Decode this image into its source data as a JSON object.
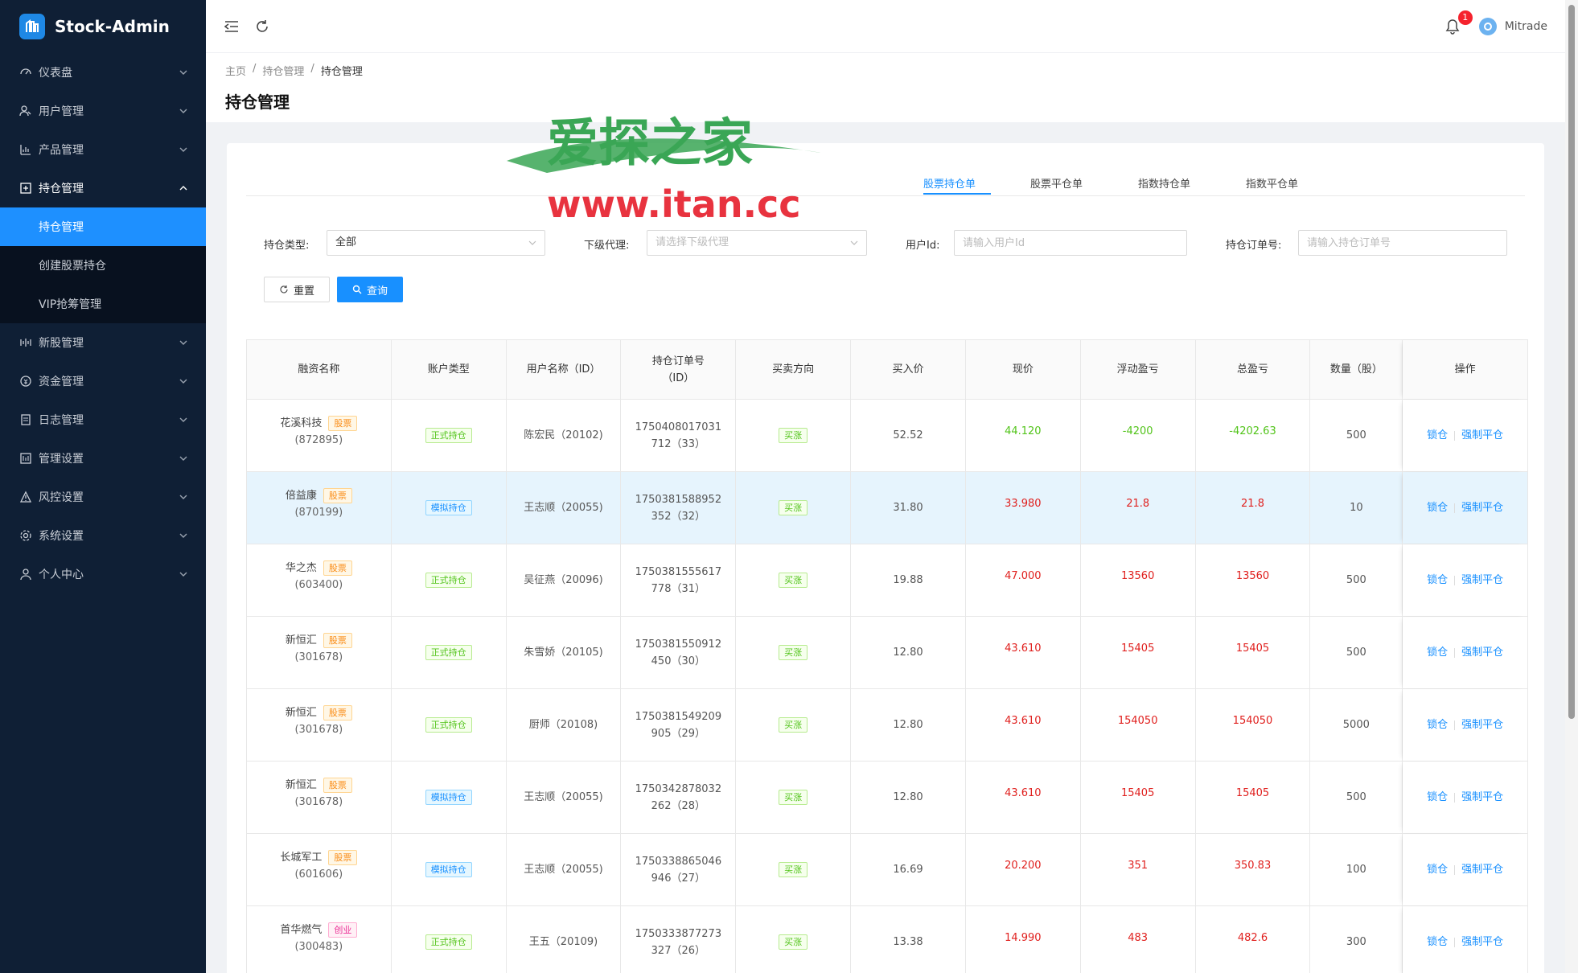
{
  "app": {
    "title": "Stock-Admin"
  },
  "sidebar": {
    "items": [
      {
        "label": "仪表盘",
        "icon": "dashboard-icon"
      },
      {
        "label": "用户管理",
        "icon": "users-icon"
      },
      {
        "label": "产品管理",
        "icon": "chart-icon"
      },
      {
        "label": "持仓管理",
        "icon": "position-icon",
        "open": true
      },
      {
        "label": "新股管理",
        "icon": "ipo-icon"
      },
      {
        "label": "资金管理",
        "icon": "money-icon"
      },
      {
        "label": "日志管理",
        "icon": "log-icon"
      },
      {
        "label": "管理设置",
        "icon": "admin-settings-icon"
      },
      {
        "label": "风控设置",
        "icon": "risk-icon"
      },
      {
        "label": "系统设置",
        "icon": "gear-icon"
      },
      {
        "label": "个人中心",
        "icon": "user-icon"
      }
    ],
    "submenu": [
      {
        "label": "持仓管理",
        "active": true
      },
      {
        "label": "创建股票持仓"
      },
      {
        "label": "VIP抢筹管理"
      }
    ]
  },
  "header": {
    "notification_count": "1",
    "user_name": "Mitrade"
  },
  "breadcrumb": [
    "主页",
    "持仓管理",
    "持仓管理"
  ],
  "page_title": "持仓管理",
  "tabs": [
    "股票持仓单",
    "股票平仓单",
    "指数持仓单",
    "指数平仓单"
  ],
  "filters": {
    "position_type_label": "持仓类型:",
    "position_type_value": "全部",
    "agent_label": "下级代理:",
    "agent_placeholder": "请选择下级代理",
    "user_id_label": "用户Id:",
    "user_id_placeholder": "请输入用户Id",
    "order_label": "持仓订单号:",
    "order_placeholder": "请输入持仓订单号"
  },
  "buttons": {
    "reset": "重置",
    "query": "查询"
  },
  "table": {
    "headers": [
      "融资名称",
      "账户类型",
      "用户名称（ID）",
      "持仓订单号\n（ID）",
      "买卖方向",
      "买入价",
      "现价",
      "浮动盈亏",
      "总盈亏",
      "数量（股）",
      "操作"
    ],
    "actions": {
      "lock": "锁仓",
      "force_close": "强制平仓"
    },
    "rows": [
      {
        "name": "花溪科技",
        "tag": "股票",
        "tag_type": "orange",
        "code": "(872895)",
        "account": "正式持仓",
        "account_type": "green",
        "user": "陈宏民（20102)",
        "order": "1750408017031712（33）",
        "direction": "买涨",
        "buy": "52.52",
        "now": "44.120",
        "float_pl": "-4200",
        "total_pl": "-4202.63",
        "qty": "500",
        "color": "green"
      },
      {
        "name": "倍益康",
        "tag": "股票",
        "tag_type": "orange",
        "code": "(870199)",
        "account": "模拟持仓",
        "account_type": "blue",
        "user": "王志顺（20055)",
        "order": "1750381588952352（32）",
        "direction": "买涨",
        "buy": "31.80",
        "now": "33.980",
        "float_pl": "21.8",
        "total_pl": "21.8",
        "qty": "10",
        "color": "red",
        "highlight": true
      },
      {
        "name": "华之杰",
        "tag": "股票",
        "tag_type": "orange",
        "code": "(603400)",
        "account": "正式持仓",
        "account_type": "green",
        "user": "吴征燕（20096)",
        "order": "1750381555617778（31）",
        "direction": "买涨",
        "buy": "19.88",
        "now": "47.000",
        "float_pl": "13560",
        "total_pl": "13560",
        "qty": "500",
        "color": "red"
      },
      {
        "name": "新恒汇",
        "tag": "股票",
        "tag_type": "orange",
        "code": "(301678)",
        "account": "正式持仓",
        "account_type": "green",
        "user": "朱雪娇（20105)",
        "order": "1750381550912450（30）",
        "direction": "买涨",
        "buy": "12.80",
        "now": "43.610",
        "float_pl": "15405",
        "total_pl": "15405",
        "qty": "500",
        "color": "red"
      },
      {
        "name": "新恒汇",
        "tag": "股票",
        "tag_type": "orange",
        "code": "(301678)",
        "account": "正式持仓",
        "account_type": "green",
        "user": "厨师（20108)",
        "order": "1750381549209905（29）",
        "direction": "买涨",
        "buy": "12.80",
        "now": "43.610",
        "float_pl": "154050",
        "total_pl": "154050",
        "qty": "5000",
        "color": "red"
      },
      {
        "name": "新恒汇",
        "tag": "股票",
        "tag_type": "orange",
        "code": "(301678)",
        "account": "模拟持仓",
        "account_type": "blue",
        "user": "王志顺（20055)",
        "order": "1750342878032262（28）",
        "direction": "买涨",
        "buy": "12.80",
        "now": "43.610",
        "float_pl": "15405",
        "total_pl": "15405",
        "qty": "500",
        "color": "red"
      },
      {
        "name": "长城军工",
        "tag": "股票",
        "tag_type": "orange",
        "code": "(601606)",
        "account": "模拟持仓",
        "account_type": "blue",
        "user": "王志顺（20055)",
        "order": "1750338865046946（27）",
        "direction": "买涨",
        "buy": "16.69",
        "now": "20.200",
        "float_pl": "351",
        "total_pl": "350.83",
        "qty": "100",
        "color": "red"
      },
      {
        "name": "首华燃气",
        "tag": "创业",
        "tag_type": "pink",
        "code": "(300483)",
        "account": "正式持仓",
        "account_type": "green",
        "user": "王五（20109)",
        "order": "1750333877273327（26）",
        "direction": "买涨",
        "buy": "13.38",
        "now": "14.990",
        "float_pl": "483",
        "total_pl": "482.6",
        "qty": "300",
        "color": "red"
      }
    ]
  },
  "watermark": {
    "title": "爱探之家",
    "url": "www.itan.cc"
  }
}
